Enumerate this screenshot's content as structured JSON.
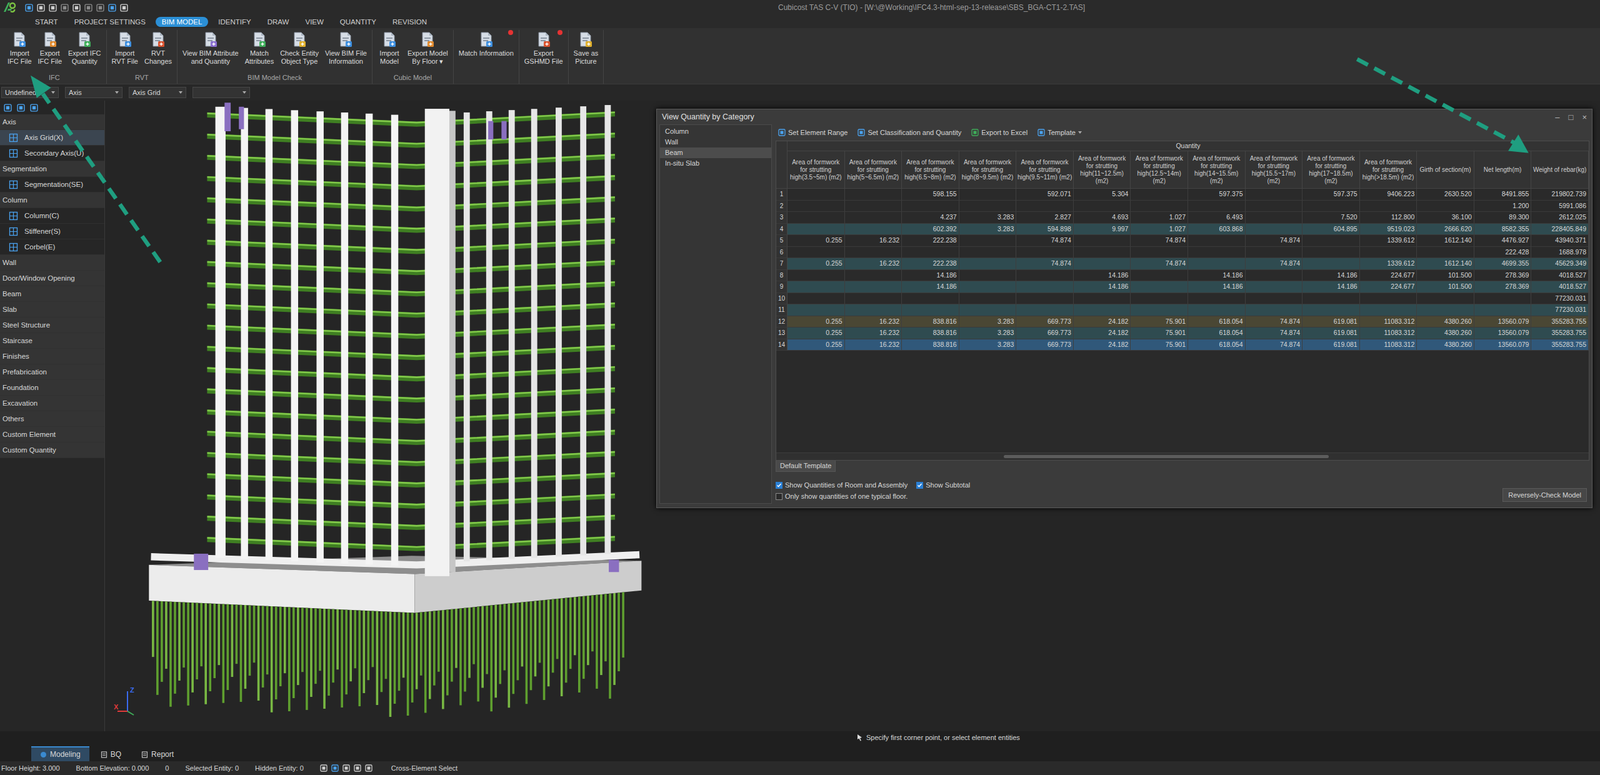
{
  "window": {
    "title": "Cubicost TAS C-V (TIO) - [W:\\@Working\\IFC4.3-html-sep-13-release\\SBS_BGA-CT1-2.TAS]"
  },
  "menu_tabs": [
    {
      "label": "START",
      "selected": false
    },
    {
      "label": "PROJECT SETTINGS",
      "selected": false
    },
    {
      "label": "BIM MODEL",
      "selected": true
    },
    {
      "label": "IDENTIFY",
      "selected": false
    },
    {
      "label": "DRAW",
      "selected": false
    },
    {
      "label": "VIEW",
      "selected": false
    },
    {
      "label": "QUANTITY",
      "selected": false
    },
    {
      "label": "REVISION",
      "selected": false
    }
  ],
  "ribbon": {
    "groups": [
      {
        "label": "IFC",
        "buttons": [
          {
            "lines": [
              "Import",
              "IFC File"
            ],
            "badge": false
          },
          {
            "lines": [
              "Export",
              "IFC File"
            ],
            "badge": false
          },
          {
            "lines": [
              "Export IFC",
              "Quantity"
            ],
            "badge": false
          }
        ]
      },
      {
        "label": "RVT",
        "buttons": [
          {
            "lines": [
              "Import",
              "RVT File"
            ],
            "badge": false
          },
          {
            "lines": [
              "RVT",
              "Changes"
            ],
            "badge": false
          }
        ]
      },
      {
        "label": "BIM Model Check",
        "buttons": [
          {
            "lines": [
              "View BIM Attribute",
              "and Quantity"
            ],
            "badge": false
          },
          {
            "lines": [
              "Match",
              "Attributes"
            ],
            "badge": false
          },
          {
            "lines": [
              "Check Entity",
              "Object Type"
            ],
            "badge": false
          },
          {
            "lines": [
              "View BIM File",
              "Information"
            ],
            "badge": false
          }
        ]
      },
      {
        "label": "Cubic Model",
        "buttons": [
          {
            "lines": [
              "Import",
              "Model"
            ],
            "badge": false
          },
          {
            "lines": [
              "Export Model",
              "By Floor ▾"
            ],
            "badge": false
          }
        ]
      },
      {
        "buttons": [
          {
            "lines": [
              "Match Information"
            ],
            "badge": true
          }
        ]
      },
      {
        "buttons": [
          {
            "lines": [
              "Export",
              "GSHMD File"
            ],
            "badge": true
          }
        ]
      },
      {
        "buttons": [
          {
            "lines": [
              "Save as",
              "Picture"
            ],
            "badge": false
          }
        ]
      }
    ]
  },
  "toolbar": {
    "dropdowns": [
      "Undefined",
      "Axis",
      "Axis Grid",
      ""
    ]
  },
  "sidebar": {
    "items": [
      {
        "label": "Axis",
        "kind": "group",
        "selected": false
      },
      {
        "label": "Axis Grid(X)",
        "kind": "item",
        "selected": true
      },
      {
        "label": "Secondary Axis(U)",
        "kind": "item",
        "selected": false
      },
      {
        "label": "Segmentation",
        "kind": "group",
        "selected": false
      },
      {
        "label": "Segmentation(SE)",
        "kind": "item",
        "selected": false
      },
      {
        "label": "Column",
        "kind": "group",
        "selected": false
      },
      {
        "label": "Column(C)",
        "kind": "item",
        "selected": false
      },
      {
        "label": "Stiffener(S)",
        "kind": "item",
        "selected": false
      },
      {
        "label": "Corbel(E)",
        "kind": "item",
        "selected": false
      },
      {
        "label": "Wall",
        "kind": "group",
        "selected": false
      },
      {
        "label": "Door/Window Opening",
        "kind": "group",
        "selected": false
      },
      {
        "label": "Beam",
        "kind": "group",
        "selected": false
      },
      {
        "label": "Slab",
        "kind": "group",
        "selected": false
      },
      {
        "label": "Steel Structure",
        "kind": "group",
        "selected": false
      },
      {
        "label": "Staircase",
        "kind": "group",
        "selected": false
      },
      {
        "label": "Finishes",
        "kind": "group",
        "selected": false
      },
      {
        "label": "Prefabrication",
        "kind": "group",
        "selected": false
      },
      {
        "label": "Foundation",
        "kind": "group",
        "selected": false
      },
      {
        "label": "Excavation",
        "kind": "group",
        "selected": false
      },
      {
        "label": "Others",
        "kind": "group",
        "selected": false
      },
      {
        "label": "Custom Element",
        "kind": "group",
        "selected": false
      },
      {
        "label": "Custom Quantity",
        "kind": "group",
        "selected": false
      }
    ]
  },
  "viewport": {
    "axes": [
      {
        "label": "Z",
        "color": "#3a6cf0"
      },
      {
        "label": "X",
        "color": "#e03a3a"
      }
    ]
  },
  "dialog": {
    "title": "View Quantity by Category",
    "controls": [
      "–",
      "□",
      "×"
    ],
    "categories": [
      {
        "label": "Column",
        "selected": false
      },
      {
        "label": "Wall",
        "selected": false
      },
      {
        "label": "Beam",
        "selected": true
      },
      {
        "label": "In-situ Slab",
        "selected": false
      }
    ],
    "toolbar": [
      "Set Element Range",
      "Set Classification and Quantity",
      "Export to Excel",
      "Template"
    ],
    "table": {
      "group_header": "Quantity",
      "columns": [
        "Area of formwork for strutting high(3.5~5m) (m2)",
        "Area of formwork for strutting high(5~6.5m) (m2)",
        "Area of formwork for strutting high(6.5~8m) (m2)",
        "Area of formwork for strutting high(8~9.5m) (m2)",
        "Area of formwork for strutting high(9.5~11m) (m2)",
        "Area of formwork for strutting high(11~12.5m) (m2)",
        "Area of formwork for strutting high(12.5~14m) (m2)",
        "Area of formwork for strutting high(14~15.5m) (m2)",
        "Area of formwork for strutting high(15.5~17m) (m2)",
        "Area of formwork for strutting high(17~18.5m) (m2)",
        "Area of formwork for strutting high(>18.5m) (m2)",
        "Girth of section(m)",
        "Net length(m)",
        "Weight of rebar(kg)"
      ],
      "rows": [
        {
          "num": "1",
          "kind": "plain",
          "selected": false,
          "cells": [
            "",
            "",
            "598.155",
            "",
            "592.071",
            "5.304",
            "",
            "597.375",
            "",
            "597.375",
            "9406.223",
            "2630.520",
            "8491.855",
            "219802.739"
          ]
        },
        {
          "num": "2",
          "kind": "plain",
          "selected": false,
          "cells": [
            "",
            "",
            "",
            "",
            "",
            "",
            "",
            "",
            "",
            "",
            "",
            "",
            "1.200",
            "5991.086"
          ]
        },
        {
          "num": "3",
          "kind": "plain",
          "selected": false,
          "cells": [
            "",
            "",
            "4.237",
            "3.283",
            "2.827",
            "4.693",
            "1.027",
            "6.493",
            "",
            "7.520",
            "112.800",
            "36.100",
            "89.300",
            "2612.025"
          ]
        },
        {
          "num": "4",
          "kind": "subtotal",
          "selected": false,
          "cells": [
            "",
            "",
            "602.392",
            "3.283",
            "594.898",
            "9.997",
            "1.027",
            "603.868",
            "",
            "604.895",
            "9519.023",
            "2666.620",
            "8582.355",
            "228405.849"
          ]
        },
        {
          "num": "5",
          "kind": "plain",
          "selected": false,
          "cells": [
            "0.255",
            "16.232",
            "222.238",
            "",
            "74.874",
            "",
            "74.874",
            "",
            "74.874",
            "",
            "1339.612",
            "1612.140",
            "4476.927",
            "43940.371"
          ]
        },
        {
          "num": "6",
          "kind": "plain",
          "selected": false,
          "cells": [
            "",
            "",
            "",
            "",
            "",
            "",
            "",
            "",
            "",
            "",
            "",
            "",
            "222.428",
            "1688.978"
          ]
        },
        {
          "num": "7",
          "kind": "subtotal",
          "selected": false,
          "cells": [
            "0.255",
            "16.232",
            "222.238",
            "",
            "74.874",
            "",
            "74.874",
            "",
            "74.874",
            "",
            "1339.612",
            "1612.140",
            "4699.355",
            "45629.349"
          ]
        },
        {
          "num": "8",
          "kind": "plain",
          "selected": false,
          "cells": [
            "",
            "",
            "14.186",
            "",
            "",
            "14.186",
            "",
            "14.186",
            "",
            "14.186",
            "224.677",
            "101.500",
            "278.369",
            "4018.527"
          ]
        },
        {
          "num": "9",
          "kind": "subtotal",
          "selected": false,
          "cells": [
            "",
            "",
            "14.186",
            "",
            "",
            "14.186",
            "",
            "14.186",
            "",
            "14.186",
            "224.677",
            "101.500",
            "278.369",
            "4018.527"
          ]
        },
        {
          "num": "10",
          "kind": "plain",
          "selected": false,
          "cells": [
            "",
            "",
            "",
            "",
            "",
            "",
            "",
            "",
            "",
            "",
            "",
            "",
            "",
            "77230.031"
          ]
        },
        {
          "num": "11",
          "kind": "subtotal",
          "selected": false,
          "cells": [
            "",
            "",
            "",
            "",
            "",
            "",
            "",
            "",
            "",
            "",
            "",
            "",
            "",
            "77230.031"
          ]
        },
        {
          "num": "12",
          "kind": "grand",
          "selected": false,
          "cells": [
            "0.255",
            "16.232",
            "838.816",
            "3.283",
            "669.773",
            "24.182",
            "75.901",
            "618.054",
            "74.874",
            "619.081",
            "11083.312",
            "4380.260",
            "13560.079",
            "355283.755"
          ]
        },
        {
          "num": "13",
          "kind": "subtotal",
          "selected": false,
          "cells": [
            "0.255",
            "16.232",
            "838.816",
            "3.283",
            "669.773",
            "24.182",
            "75.901",
            "618.054",
            "74.874",
            "619.081",
            "11083.312",
            "4380.260",
            "13560.079",
            "355283.755"
          ]
        },
        {
          "num": "14",
          "kind": "plain",
          "selected": true,
          "cells": [
            "0.255",
            "16.232",
            "838.816",
            "3.283",
            "669.773",
            "24.182",
            "75.901",
            "618.054",
            "74.874",
            "619.081",
            "11083.312",
            "4380.260",
            "13560.079",
            "355283.755"
          ]
        }
      ],
      "h_scroll": {
        "start": 0.28,
        "level": 0.4
      }
    },
    "template_tab": "Default Template",
    "checkboxes": [
      {
        "label": "Show Quantities of Room and Assembly",
        "checked": true
      },
      {
        "label": "Show Subtotal",
        "checked": true
      },
      {
        "label": "Only show quantities of one typical floor.",
        "checked": false
      }
    ],
    "button": "Reversely-Check Model"
  },
  "prompt": "Specify first corner point, or select element entities",
  "bottom_tabs": [
    {
      "label": "Modeling",
      "selected": true
    },
    {
      "label": "BQ",
      "selected": false
    },
    {
      "label": "Report",
      "selected": false
    }
  ],
  "status_bar": {
    "items": [
      "Floor Height: 3.000",
      "Bottom Elevation: 0.000",
      "0",
      "Selected Entity: 0",
      "Hidden Entity: 0"
    ],
    "select_mode": "Cross-Element Select"
  }
}
